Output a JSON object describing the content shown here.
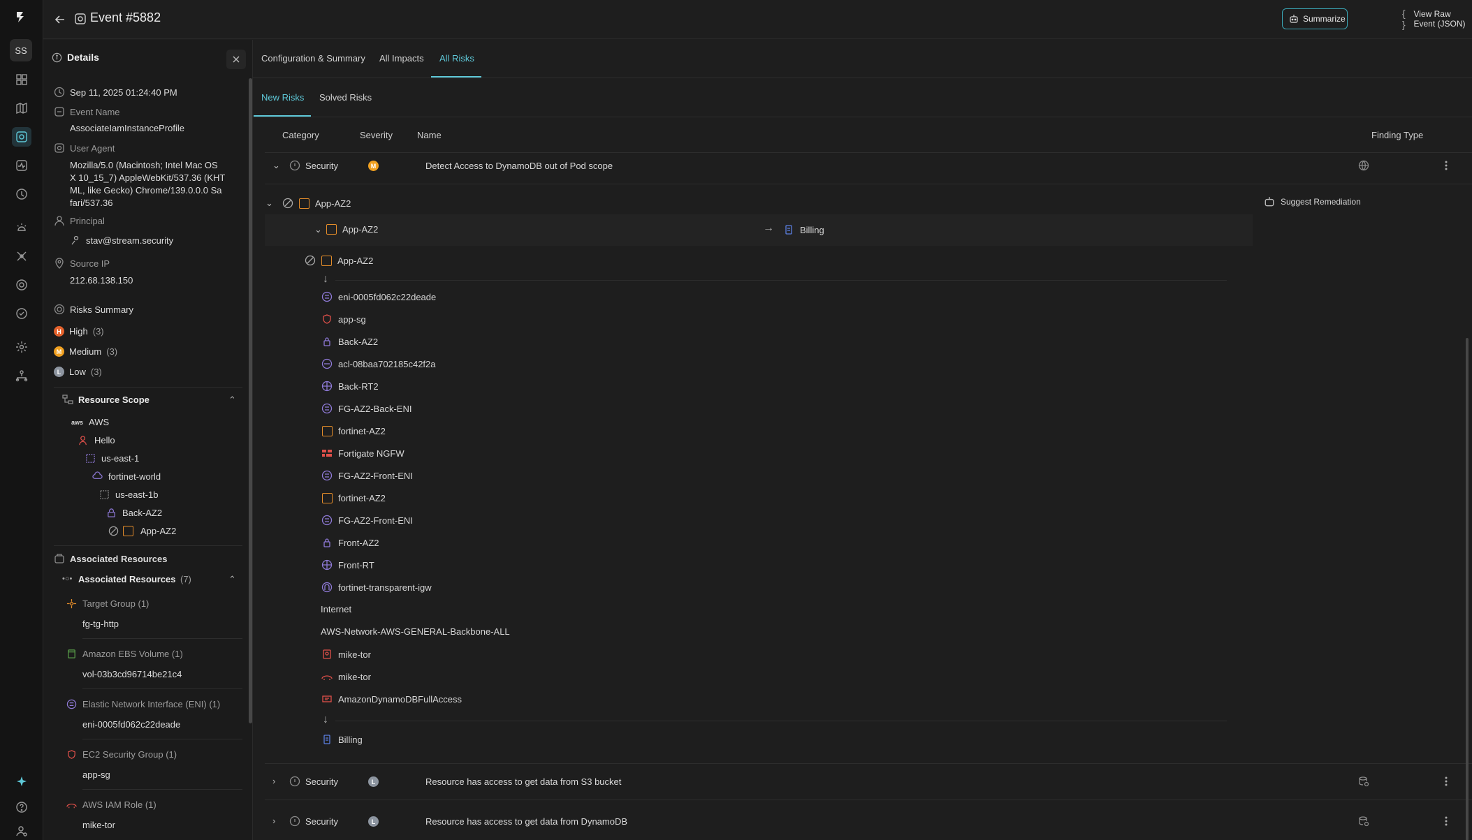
{
  "topbar": {
    "title": "Event #5882",
    "summarize": "Summarize",
    "view_raw": "View Raw Event (JSON)"
  },
  "rail": {
    "avatar": "SS"
  },
  "details": {
    "header": "Details",
    "timestamp": "Sep 11, 2025 01:24:40 PM",
    "event_name_label": "Event Name",
    "event_name": "AssociateIamInstanceProfile",
    "user_agent_label": "User Agent",
    "user_agent_lines": [
      "Mozilla/5.0 (Macintosh; Intel Mac OS",
      "X 10_15_7) AppleWebKit/537.36 (KHT",
      "ML, like Gecko) Chrome/139.0.0.0 Sa",
      "fari/537.36"
    ],
    "principal_label": "Principal",
    "principal": "stav@stream.security",
    "source_ip_label": "Source IP",
    "source_ip": "212.68.138.150",
    "risks_summary_label": "Risks Summary",
    "risks": [
      {
        "badge": "H",
        "label": "High",
        "count": "(3)"
      },
      {
        "badge": "M",
        "label": "Medium",
        "count": "(3)"
      },
      {
        "badge": "L",
        "label": "Low",
        "count": "(3)"
      }
    ],
    "resource_scope_label": "Resource Scope",
    "scope_tree": [
      "AWS",
      "Hello",
      "us-east-1",
      "fortinet-world",
      "us-east-1b",
      "Back-AZ2",
      "App-AZ2"
    ],
    "associated_label": "Associated Resources",
    "associated_sub_label": "Associated Resources",
    "associated_count": "(7)",
    "associated": [
      {
        "type": "Target Group (1)",
        "name": "fg-tg-http"
      },
      {
        "type": "Amazon EBS Volume (1)",
        "name": "vol-03b3cd96714be21c4"
      },
      {
        "type": "Elastic Network Interface (ENI) (1)",
        "name": "eni-0005fd062c22deade"
      },
      {
        "type": "EC2 Security Group (1)",
        "name": "app-sg"
      },
      {
        "type": "AWS IAM Role (1)",
        "name": "mike-tor"
      }
    ]
  },
  "tabs": [
    "Configuration & Summary",
    "All Impacts",
    "All Risks"
  ],
  "subtabs": [
    "New Risks",
    "Solved Risks"
  ],
  "columns": {
    "category": "Category",
    "severity": "Severity",
    "name": "Name",
    "finding_type": "Finding Type"
  },
  "risk_rows": [
    {
      "category": "Security",
      "severity": "M",
      "name": "Detect Access to DynamoDB out of Pod scope"
    },
    {
      "category": "Security",
      "severity": "L",
      "name": "Resource has access to get data from S3 bucket"
    },
    {
      "category": "Security",
      "severity": "L",
      "name": "Resource has access to get data from DynamoDB"
    }
  ],
  "expanded": {
    "group_name": "App-AZ2",
    "suggest": "Suggest Remediation",
    "path_source": "App-AZ2",
    "path_target": "Billing",
    "root": "App-AZ2",
    "nodes": [
      "eni-0005fd062c22deade",
      "app-sg",
      "Back-AZ2",
      "acl-08baa702185c42f2a",
      "Back-RT2",
      "FG-AZ2-Back-ENI",
      "fortinet-AZ2",
      "Fortigate NGFW",
      "FG-AZ2-Front-ENI",
      "fortinet-AZ2",
      "FG-AZ2-Front-ENI",
      "Front-AZ2",
      "Front-RT",
      "fortinet-transparent-igw",
      "Internet",
      "AWS-Network-AWS-GENERAL-Backbone-ALL",
      "mike-tor",
      "mike-tor",
      "AmazonDynamoDBFullAccess"
    ],
    "end": "Billing"
  },
  "colors": {
    "accent": "#5ec8d8",
    "high": "#e4622c",
    "medium": "#f0a020",
    "low": "#8d95a0",
    "resource": "#e38c2a",
    "network": "#8f7ad8",
    "iam": "#e0504a"
  }
}
